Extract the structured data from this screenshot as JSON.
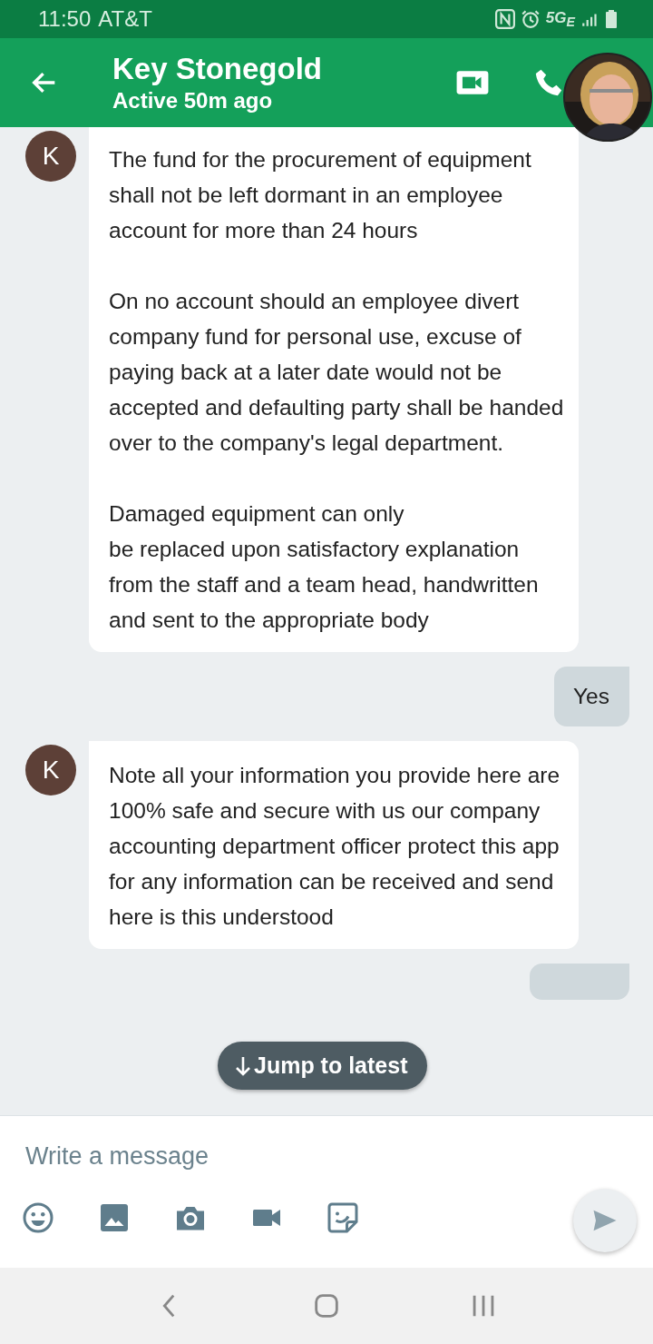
{
  "status_bar": {
    "time": "11:50",
    "carrier": "AT&T",
    "network": "5G$_{E}$"
  },
  "header": {
    "title": "Key Stonegold",
    "subtitle": "Active 50m ago"
  },
  "messages": [
    {
      "kind": "received",
      "avatar": "K",
      "text": "The fund for the procurement of equipment shall not be left dormant in an employee account for more than 24 hours\n\nOn no account should an employee divert company fund for personal use, excuse of paying back at a later date would not be accepted and defaulting party shall be handed over to the company's legal department.\n\nDamaged equipment can only\nbe replaced upon satisfactory explanation from the staff and a team head, handwritten and sent to the appropriate body"
    },
    {
      "kind": "sent",
      "text": "Yes"
    },
    {
      "kind": "received",
      "avatar": "K",
      "text": "Note all your information you provide here are 100% safe and secure with us our company accounting department officer protect this app for any information can be received and send here is this understood"
    },
    {
      "kind": "sent_partial"
    }
  ],
  "jump_button": "Jump to latest",
  "composer": {
    "placeholder": "Write a message"
  }
}
